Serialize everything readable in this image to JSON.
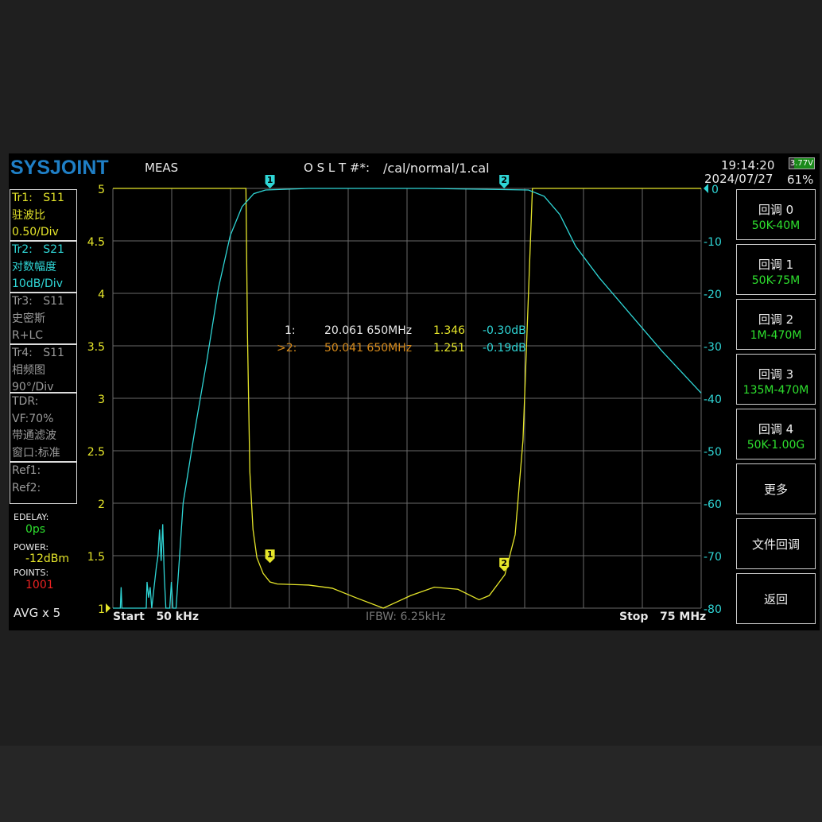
{
  "header": {
    "logo": "SYSJOINT",
    "mode": "MEAS",
    "cal_label": "O S L T #*:",
    "cal_file": "/cal/normal/1.cal",
    "time": "19:14:20",
    "date": "2024/07/27",
    "battery_voltage": "3.77V",
    "battery_percent": "61%"
  },
  "traces": [
    {
      "l1": "Tr1:   S11",
      "l2": "驻波比",
      "l3": "0.50/Div"
    },
    {
      "l1": "Tr2:   S21",
      "l2": "对数幅度",
      "l3": "10dB/Div"
    },
    {
      "l1": "Tr3:   S11",
      "l2": "史密斯",
      "l3": "R+LC"
    },
    {
      "l1": "Tr4:   S11",
      "l2": "相频图",
      "l3": "90°/Div"
    }
  ],
  "tdr": {
    "l1": "TDR:",
    "l2": "VF:70%",
    "l3": "带通滤波",
    "l4": "窗口:标准"
  },
  "refs": {
    "r1": "Ref1:",
    "r2": "Ref2:"
  },
  "status": {
    "edelay_label": "EDELAY:",
    "edelay": "0ps",
    "power_label": "POWER:",
    "power": "-12dBm",
    "points_label": "POINTS:",
    "points": "1001",
    "avg": "AVG x 5"
  },
  "footer": {
    "start": "Start   50 kHz",
    "ifbw": "IFBW: 6.25kHz",
    "stop": "Stop   75 MHz"
  },
  "markers_readout": [
    {
      "id": "1:",
      "freq": "20.061 650MHz",
      "swr": "1.346",
      "db": "-0.30dB"
    },
    {
      "id": ">2:",
      "freq": "50.041 650MHz",
      "swr": "1.251",
      "db": "-0.19dB"
    }
  ],
  "buttons": [
    {
      "label": "回调 0",
      "sub": "50K-40M"
    },
    {
      "label": "回调 1",
      "sub": "50K-75M"
    },
    {
      "label": "回调 2",
      "sub": "1M-470M"
    },
    {
      "label": "回调 3",
      "sub": "135M-470M"
    },
    {
      "label": "回调 4",
      "sub": "50K-1.00G"
    },
    {
      "label": "更多"
    },
    {
      "label": "文件回调"
    },
    {
      "label": "返回"
    }
  ],
  "colors": {
    "swr": "#e6e62a",
    "s21": "#2fd6d6",
    "grid": "#6a6a6a"
  },
  "chart_data": {
    "type": "line",
    "x_unit": "MHz",
    "xlim": [
      0.05,
      75
    ],
    "left_axis": {
      "ylim": [
        1,
        5
      ],
      "ticks": [
        "1",
        "1.5",
        "2",
        "2.5",
        "3",
        "3.5",
        "4",
        "4.5",
        "5"
      ]
    },
    "right_axis": {
      "ylim": [
        -80,
        0
      ],
      "ticks": [
        "0",
        "-10",
        "-20",
        "-30",
        "-40",
        "-50",
        "-60",
        "-70",
        "-80"
      ]
    },
    "series": [
      {
        "name": "Tr1 S11 SWR",
        "axis": "left",
        "points": [
          [
            0.05,
            5
          ],
          [
            17.0,
            5
          ],
          [
            17.2,
            3.6
          ],
          [
            17.5,
            2.3
          ],
          [
            17.9,
            1.75
          ],
          [
            18.4,
            1.48
          ],
          [
            19.2,
            1.33
          ],
          [
            20.06,
            1.25
          ],
          [
            21,
            1.23
          ],
          [
            25,
            1.22
          ],
          [
            28,
            1.19
          ],
          [
            31,
            1.1
          ],
          [
            34.5,
            1.0
          ],
          [
            38,
            1.12
          ],
          [
            41,
            1.2
          ],
          [
            44,
            1.18
          ],
          [
            46.7,
            1.08
          ],
          [
            48,
            1.12
          ],
          [
            50,
            1.32
          ],
          [
            51.3,
            1.7
          ],
          [
            52.3,
            2.6
          ],
          [
            52.9,
            3.8
          ],
          [
            53.5,
            5
          ],
          [
            75,
            5
          ]
        ]
      },
      {
        "name": "Tr2 S21 LogMag",
        "axis": "right",
        "points": [
          [
            0.05,
            -80
          ],
          [
            1.0,
            -80
          ],
          [
            1.1,
            -76
          ],
          [
            1.2,
            -80
          ],
          [
            4.3,
            -80
          ],
          [
            4.4,
            -75
          ],
          [
            4.6,
            -78
          ],
          [
            4.8,
            -76
          ],
          [
            5.0,
            -80
          ],
          [
            5.3,
            -76
          ],
          [
            5.6,
            -72
          ],
          [
            5.8,
            -70
          ],
          [
            6.0,
            -65
          ],
          [
            6.2,
            -71
          ],
          [
            6.4,
            -64
          ],
          [
            6.6,
            -74
          ],
          [
            6.8,
            -80
          ],
          [
            7.3,
            -80
          ],
          [
            7.5,
            -75
          ],
          [
            7.7,
            -80
          ],
          [
            8.1,
            -80
          ],
          [
            9,
            -60
          ],
          [
            10.5,
            -46
          ],
          [
            12,
            -33
          ],
          [
            13.5,
            -19
          ],
          [
            15,
            -9
          ],
          [
            16.5,
            -3.5
          ],
          [
            18,
            -1
          ],
          [
            19.5,
            -0.3
          ],
          [
            25,
            0
          ],
          [
            40,
            0
          ],
          [
            53,
            -0.3
          ],
          [
            55,
            -1.5
          ],
          [
            57,
            -5
          ],
          [
            59,
            -11
          ],
          [
            62,
            -17
          ],
          [
            66,
            -24
          ],
          [
            70,
            -31
          ],
          [
            75,
            -39
          ]
        ]
      }
    ],
    "markers": [
      {
        "id": "1",
        "freq": 20.06,
        "swr": 1.43,
        "s21": 0
      },
      {
        "id": "2",
        "freq": 49.9,
        "swr": 1.35,
        "s21": 0
      }
    ]
  }
}
